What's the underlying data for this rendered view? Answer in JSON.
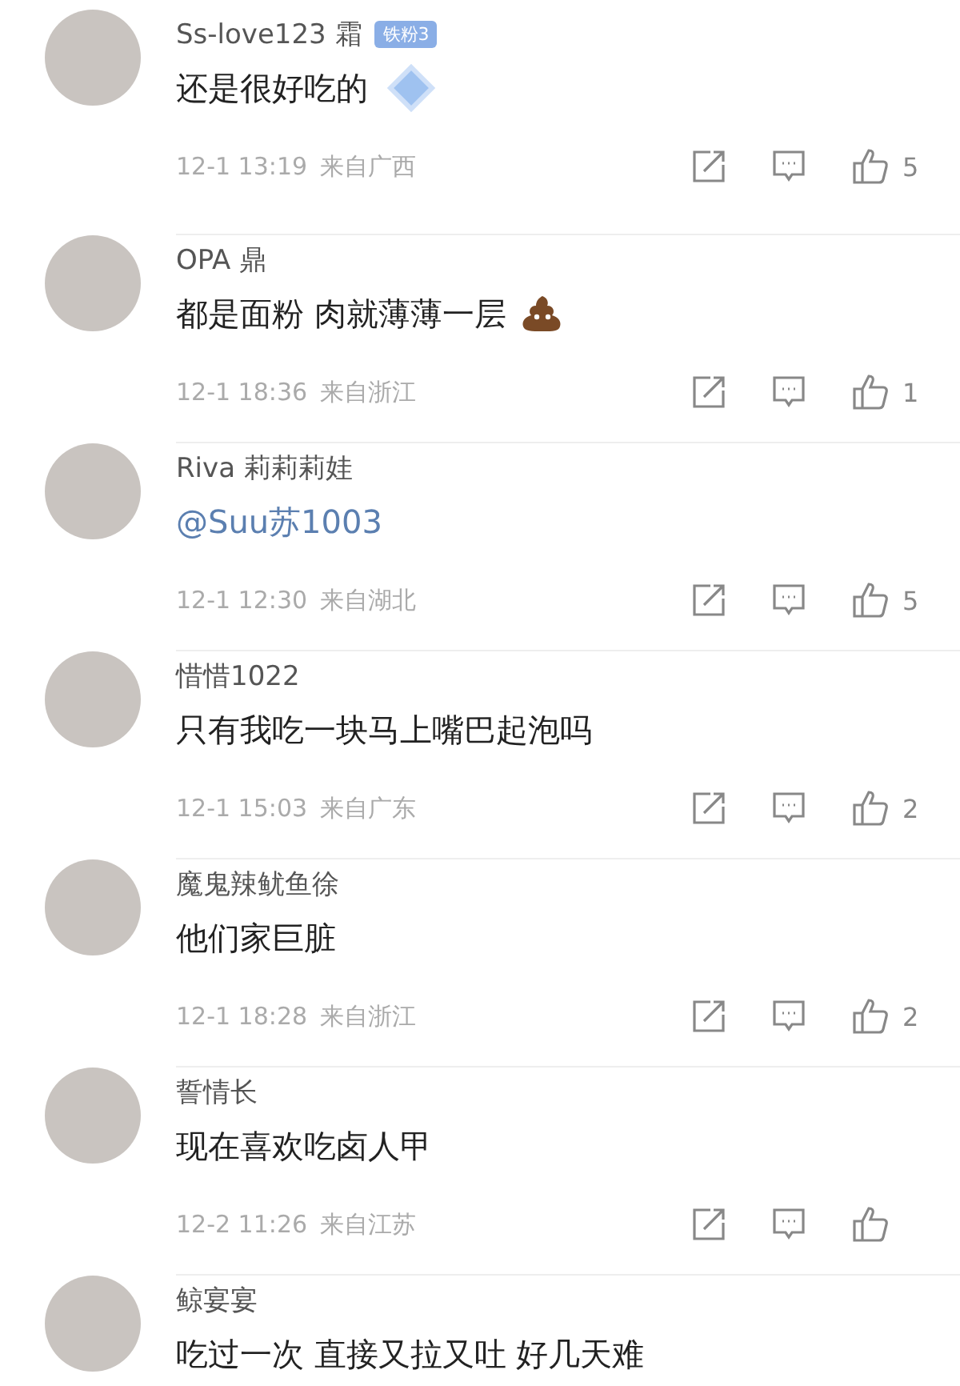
{
  "comments": [
    {
      "user": "Ss-love123 霜",
      "badge": "铁粉3",
      "text": "还是很好吃的",
      "sticker": true,
      "date": "12-1 13:19",
      "location": "来自广西",
      "likes": "5"
    },
    {
      "user": "OPA 鼎",
      "text": "都是面粉 肉就薄薄一层",
      "emoji": true,
      "date": "12-1 18:36",
      "location": "来自浙江",
      "likes": "1"
    },
    {
      "user": "Riva 莉莉莉娃",
      "text": "@Suu苏1003",
      "mention": true,
      "date": "12-1 12:30",
      "location": "来自湖北",
      "likes": "5"
    },
    {
      "user": "惜惜1022",
      "text": "只有我吃一块马上嘴巴起泡吗",
      "date": "12-1 15:03",
      "location": "来自广东",
      "likes": "2"
    },
    {
      "user": "魔鬼辣鱿鱼徐",
      "text": "他们家巨脏",
      "date": "12-1 18:28",
      "location": "来自浙江",
      "likes": "2"
    },
    {
      "user": "誓情长",
      "text": "现在喜欢吃卤人甲",
      "date": "12-2 11:26",
      "location": "来自江苏"
    },
    {
      "user": "鲸宴宴",
      "text": "吃过一次 直接又拉又吐 好几天难"
    }
  ]
}
